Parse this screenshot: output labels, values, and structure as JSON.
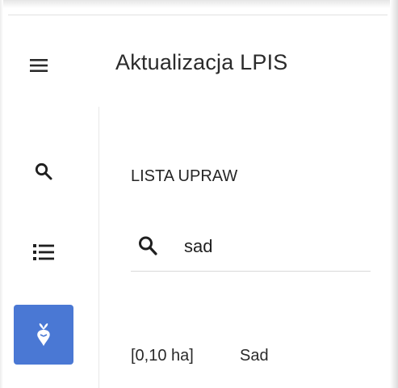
{
  "header": {
    "title": "Aktualizacja LPIS",
    "menu_icon": "hamburger-menu-icon"
  },
  "rail": {
    "items": [
      {
        "icon": "search-icon",
        "active": false
      },
      {
        "icon": "list-icon",
        "active": false
      },
      {
        "icon": "crop-beet-icon",
        "active": true
      }
    ],
    "active_color": "#4a78d4"
  },
  "crops_panel": {
    "title": "LISTA UPRAW",
    "search": {
      "value": "sad",
      "icon": "search-icon"
    },
    "results": [
      {
        "area": "[0,10 ha]",
        "name": "Sad"
      }
    ]
  }
}
